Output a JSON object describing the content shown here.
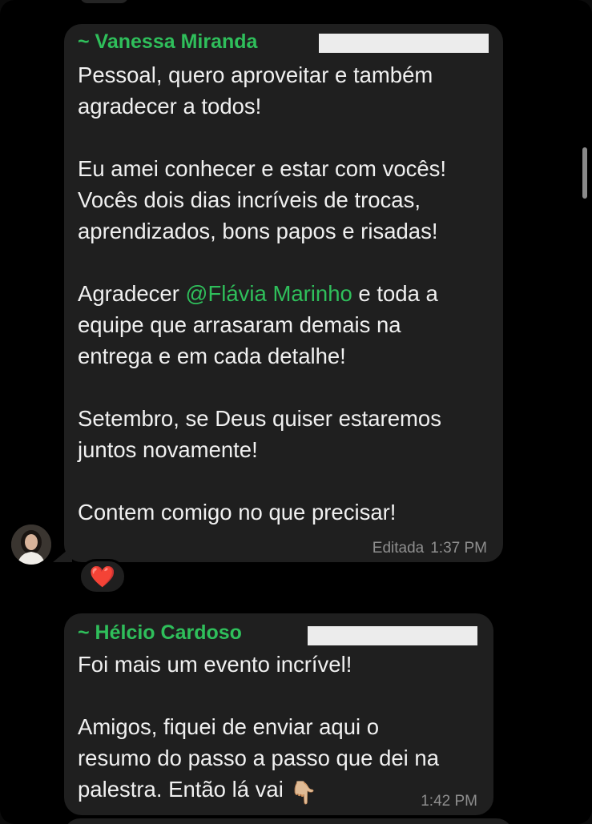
{
  "messages": [
    {
      "sender": "~ Vanessa Miranda",
      "text_before_mention": "Pessoal, quero aproveitar e também\nagradecer a todos!\n\nEu amei conhecer e estar com vocês!\nVocês dois dias incríveis de trocas,\naprendizados, bons papos e risadas!\n\nAgradecer ",
      "mention": "@Flávia Marinho",
      "text_after_mention": " e toda a\nequipe que arrasaram demais na\nentrega e em cada detalhe!\n\nSetembro, se Deus quiser estaremos\njuntos novamente!\n\nContem comigo no que precisar!",
      "edited_label": "Editada",
      "time": "1:37 PM",
      "reaction": "❤️"
    },
    {
      "sender": "~ Hélcio Cardoso",
      "text": "Foi mais um evento incrível!\n\nAmigos, fiquei de enviar aqui o\nresumo do passo a passo que dei na\npalestra. Então lá vai",
      "emoji": "👇🏼",
      "time": "1:42 PM"
    }
  ],
  "colors": {
    "background": "#000000",
    "bubble": "#1f1f1f",
    "sender_name": "#2fbf5b",
    "mention": "#2fbf5b",
    "timestamp": "#8e8e8e"
  },
  "icons": {
    "reaction": "heart-icon",
    "hand": "pointing-down-emoji"
  }
}
